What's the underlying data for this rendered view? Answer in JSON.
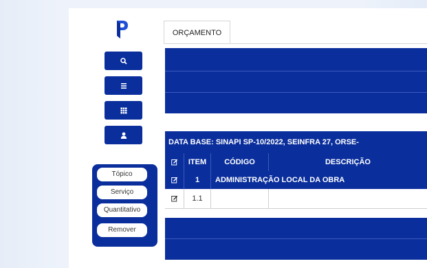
{
  "tabs": [
    {
      "label": "ORÇAMENTO"
    }
  ],
  "sidebar": {
    "buttons": [
      {
        "icon": "search-icon"
      },
      {
        "icon": "list-icon"
      },
      {
        "icon": "grid-icon"
      },
      {
        "icon": "user-icon"
      }
    ]
  },
  "actions": {
    "topico": "Tópico",
    "servico": "Serviço",
    "quantitativo": "Quantitativo",
    "remover": "Remover"
  },
  "table": {
    "database": "DATA BASE: SINAPI SP-10/2022, SEINFRA 27, ORSE-",
    "headers": {
      "item": "ITEM",
      "codigo": "CÓDIGO",
      "descricao": "DESCRIÇÃO"
    },
    "rows": [
      {
        "item": "1",
        "description": "ADMINISTRAÇÃO LOCAL DA OBRA"
      },
      {
        "item": "1.1",
        "codigo": "",
        "description": ""
      }
    ]
  },
  "colors": {
    "brand": "#0a2e9c",
    "background": "#eef3fb"
  }
}
